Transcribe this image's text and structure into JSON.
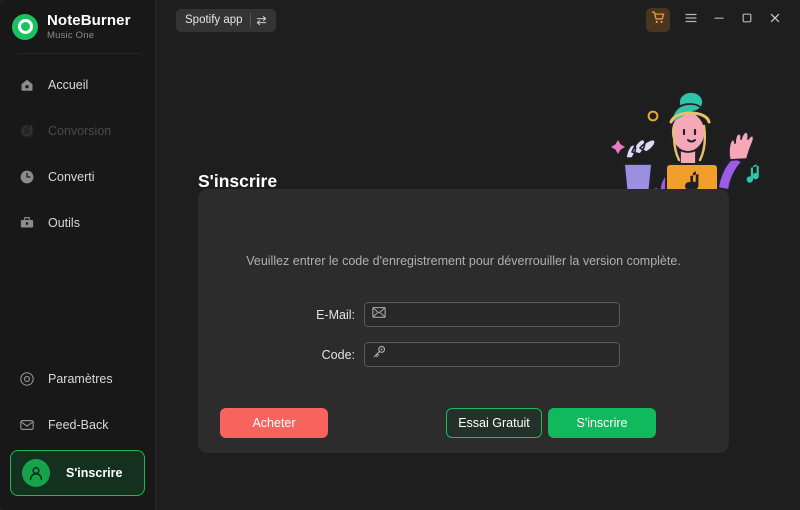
{
  "brand": {
    "name": "NoteBurner",
    "subtitle": "Music One",
    "logo_icon": "noteburner-logo-icon",
    "accent": "#19c161"
  },
  "sidebar": {
    "items": [
      {
        "label": "Accueil",
        "icon": "home-icon",
        "state": "normal"
      },
      {
        "label": "Convorsion",
        "icon": "convert-icon",
        "state": "disabled"
      },
      {
        "label": "Converti",
        "icon": "clock-icon",
        "state": "normal"
      },
      {
        "label": "Outils",
        "icon": "toolbox-icon",
        "state": "normal"
      }
    ],
    "bottom_items": [
      {
        "label": "Paramètres",
        "icon": "settings-icon"
      },
      {
        "label": "Feed-Back",
        "icon": "mail-icon"
      }
    ],
    "signin": {
      "label": "S'inscrire",
      "icon": "user-avatar-icon",
      "active": "true",
      "border_color": "#1db954"
    }
  },
  "topbar": {
    "app_selector": {
      "label": "Spotify app",
      "icon": "swap-arrows-icon"
    },
    "cart": {
      "icon": "shopping-cart-icon",
      "color": "#e89a3c"
    },
    "menu": {
      "icon": "hamburger-menu-icon"
    },
    "minimize": {
      "icon": "minimize-icon"
    },
    "maximize": {
      "icon": "maximize-icon"
    },
    "close": {
      "icon": "close-icon"
    }
  },
  "main": {
    "title": "S'inscrire",
    "illustration": {
      "name": "person-with-laptop-illustration",
      "colors": {
        "skin": "#f7a8b8",
        "shirt": "#9b5de5",
        "hair": "#2ec4a6",
        "laptop": "#f0a02a",
        "sparkle": "#e879c7",
        "circle": "#e8a33c",
        "note": "#2ec4a6"
      }
    },
    "panel": {
      "note": "Veuillez entrer le code d'enregistrement pour déverrouiller la version complète.",
      "fields": [
        {
          "label": "E-Mail:",
          "icon": "envelope-icon",
          "value": "",
          "placeholder": ""
        },
        {
          "label": "Code:",
          "icon": "key-icon",
          "value": "",
          "placeholder": ""
        }
      ],
      "buttons": {
        "buy": {
          "label": "Acheter",
          "color": "#f8635e"
        },
        "trial": {
          "label": "Essai Gratuit",
          "color": "#1db954"
        },
        "register": {
          "label": "S'inscrire",
          "color": "#10b95c"
        }
      }
    }
  }
}
